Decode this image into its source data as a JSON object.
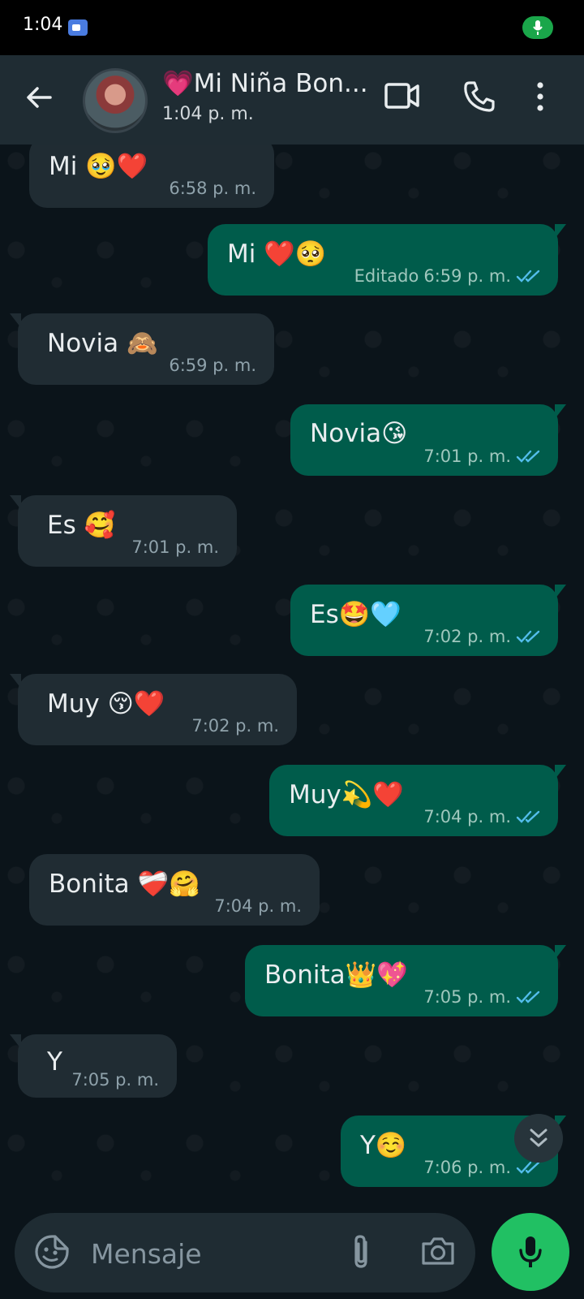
{
  "status_bar": {
    "time": "1:04"
  },
  "header": {
    "contact_name": "💗Mi Niña Bon...",
    "last_seen": "1:04 p. m."
  },
  "messages": [
    {
      "dir": "in",
      "text": "Mi 🥹❤️",
      "time": "6:58 p. m."
    },
    {
      "dir": "out",
      "text": "Mi ❤️🥺",
      "edited": "Editado",
      "time": "6:59 p. m.",
      "status": "read"
    },
    {
      "dir": "in",
      "text": "Novia 🙈",
      "time": "6:59 p. m."
    },
    {
      "dir": "out",
      "text": "Novia😘",
      "time": "7:01 p. m.",
      "status": "read"
    },
    {
      "dir": "in",
      "text": "Es 🥰",
      "time": "7:01 p. m."
    },
    {
      "dir": "out",
      "text": "Es🤩🩵",
      "time": "7:02 p. m.",
      "status": "read"
    },
    {
      "dir": "in",
      "text": "Muy 😚❤️",
      "time": "7:02 p. m."
    },
    {
      "dir": "out",
      "text": "Muy💫❤️",
      "time": "7:04 p. m.",
      "status": "read"
    },
    {
      "dir": "in",
      "text": "Bonita ❤️‍🩹🤗",
      "time": "7:04 p. m."
    },
    {
      "dir": "out",
      "text": "Bonita👑💖",
      "time": "7:05 p. m.",
      "status": "read"
    },
    {
      "dir": "in",
      "text": "Y",
      "time": "7:05 p. m."
    },
    {
      "dir": "out",
      "text": "Y☺️",
      "time": "7:06 p. m.",
      "status": "read"
    }
  ],
  "composer": {
    "placeholder": "Mensaje"
  },
  "colors": {
    "incoming_bubble": "#202c33",
    "outgoing_bubble": "#005c4b",
    "read_ticks": "#53bdeb",
    "accent_green": "#21c063"
  },
  "icons": [
    "back-arrow-icon",
    "video-call-icon",
    "voice-call-icon",
    "more-options-icon",
    "double-chevron-down-icon",
    "sticker-icon",
    "attachment-icon",
    "camera-icon",
    "microphone-icon"
  ]
}
